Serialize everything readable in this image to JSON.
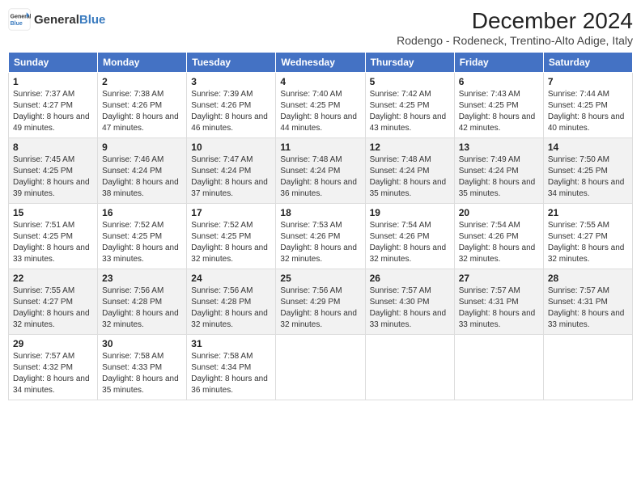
{
  "logo": {
    "text_general": "General",
    "text_blue": "Blue"
  },
  "title": "December 2024",
  "subtitle": "Rodengo - Rodeneck, Trentino-Alto Adige, Italy",
  "weekdays": [
    "Sunday",
    "Monday",
    "Tuesday",
    "Wednesday",
    "Thursday",
    "Friday",
    "Saturday"
  ],
  "weeks": [
    [
      {
        "day": "1",
        "sunrise": "7:37 AM",
        "sunset": "4:27 PM",
        "daylight": "8 hours and 49 minutes."
      },
      {
        "day": "2",
        "sunrise": "7:38 AM",
        "sunset": "4:26 PM",
        "daylight": "8 hours and 47 minutes."
      },
      {
        "day": "3",
        "sunrise": "7:39 AM",
        "sunset": "4:26 PM",
        "daylight": "8 hours and 46 minutes."
      },
      {
        "day": "4",
        "sunrise": "7:40 AM",
        "sunset": "4:25 PM",
        "daylight": "8 hours and 44 minutes."
      },
      {
        "day": "5",
        "sunrise": "7:42 AM",
        "sunset": "4:25 PM",
        "daylight": "8 hours and 43 minutes."
      },
      {
        "day": "6",
        "sunrise": "7:43 AM",
        "sunset": "4:25 PM",
        "daylight": "8 hours and 42 minutes."
      },
      {
        "day": "7",
        "sunrise": "7:44 AM",
        "sunset": "4:25 PM",
        "daylight": "8 hours and 40 minutes."
      }
    ],
    [
      {
        "day": "8",
        "sunrise": "7:45 AM",
        "sunset": "4:25 PM",
        "daylight": "8 hours and 39 minutes."
      },
      {
        "day": "9",
        "sunrise": "7:46 AM",
        "sunset": "4:24 PM",
        "daylight": "8 hours and 38 minutes."
      },
      {
        "day": "10",
        "sunrise": "7:47 AM",
        "sunset": "4:24 PM",
        "daylight": "8 hours and 37 minutes."
      },
      {
        "day": "11",
        "sunrise": "7:48 AM",
        "sunset": "4:24 PM",
        "daylight": "8 hours and 36 minutes."
      },
      {
        "day": "12",
        "sunrise": "7:48 AM",
        "sunset": "4:24 PM",
        "daylight": "8 hours and 35 minutes."
      },
      {
        "day": "13",
        "sunrise": "7:49 AM",
        "sunset": "4:24 PM",
        "daylight": "8 hours and 35 minutes."
      },
      {
        "day": "14",
        "sunrise": "7:50 AM",
        "sunset": "4:25 PM",
        "daylight": "8 hours and 34 minutes."
      }
    ],
    [
      {
        "day": "15",
        "sunrise": "7:51 AM",
        "sunset": "4:25 PM",
        "daylight": "8 hours and 33 minutes."
      },
      {
        "day": "16",
        "sunrise": "7:52 AM",
        "sunset": "4:25 PM",
        "daylight": "8 hours and 33 minutes."
      },
      {
        "day": "17",
        "sunrise": "7:52 AM",
        "sunset": "4:25 PM",
        "daylight": "8 hours and 32 minutes."
      },
      {
        "day": "18",
        "sunrise": "7:53 AM",
        "sunset": "4:26 PM",
        "daylight": "8 hours and 32 minutes."
      },
      {
        "day": "19",
        "sunrise": "7:54 AM",
        "sunset": "4:26 PM",
        "daylight": "8 hours and 32 minutes."
      },
      {
        "day": "20",
        "sunrise": "7:54 AM",
        "sunset": "4:26 PM",
        "daylight": "8 hours and 32 minutes."
      },
      {
        "day": "21",
        "sunrise": "7:55 AM",
        "sunset": "4:27 PM",
        "daylight": "8 hours and 32 minutes."
      }
    ],
    [
      {
        "day": "22",
        "sunrise": "7:55 AM",
        "sunset": "4:27 PM",
        "daylight": "8 hours and 32 minutes."
      },
      {
        "day": "23",
        "sunrise": "7:56 AM",
        "sunset": "4:28 PM",
        "daylight": "8 hours and 32 minutes."
      },
      {
        "day": "24",
        "sunrise": "7:56 AM",
        "sunset": "4:28 PM",
        "daylight": "8 hours and 32 minutes."
      },
      {
        "day": "25",
        "sunrise": "7:56 AM",
        "sunset": "4:29 PM",
        "daylight": "8 hours and 32 minutes."
      },
      {
        "day": "26",
        "sunrise": "7:57 AM",
        "sunset": "4:30 PM",
        "daylight": "8 hours and 33 minutes."
      },
      {
        "day": "27",
        "sunrise": "7:57 AM",
        "sunset": "4:31 PM",
        "daylight": "8 hours and 33 minutes."
      },
      {
        "day": "28",
        "sunrise": "7:57 AM",
        "sunset": "4:31 PM",
        "daylight": "8 hours and 33 minutes."
      }
    ],
    [
      {
        "day": "29",
        "sunrise": "7:57 AM",
        "sunset": "4:32 PM",
        "daylight": "8 hours and 34 minutes."
      },
      {
        "day": "30",
        "sunrise": "7:58 AM",
        "sunset": "4:33 PM",
        "daylight": "8 hours and 35 minutes."
      },
      {
        "day": "31",
        "sunrise": "7:58 AM",
        "sunset": "4:34 PM",
        "daylight": "8 hours and 36 minutes."
      },
      null,
      null,
      null,
      null
    ]
  ]
}
